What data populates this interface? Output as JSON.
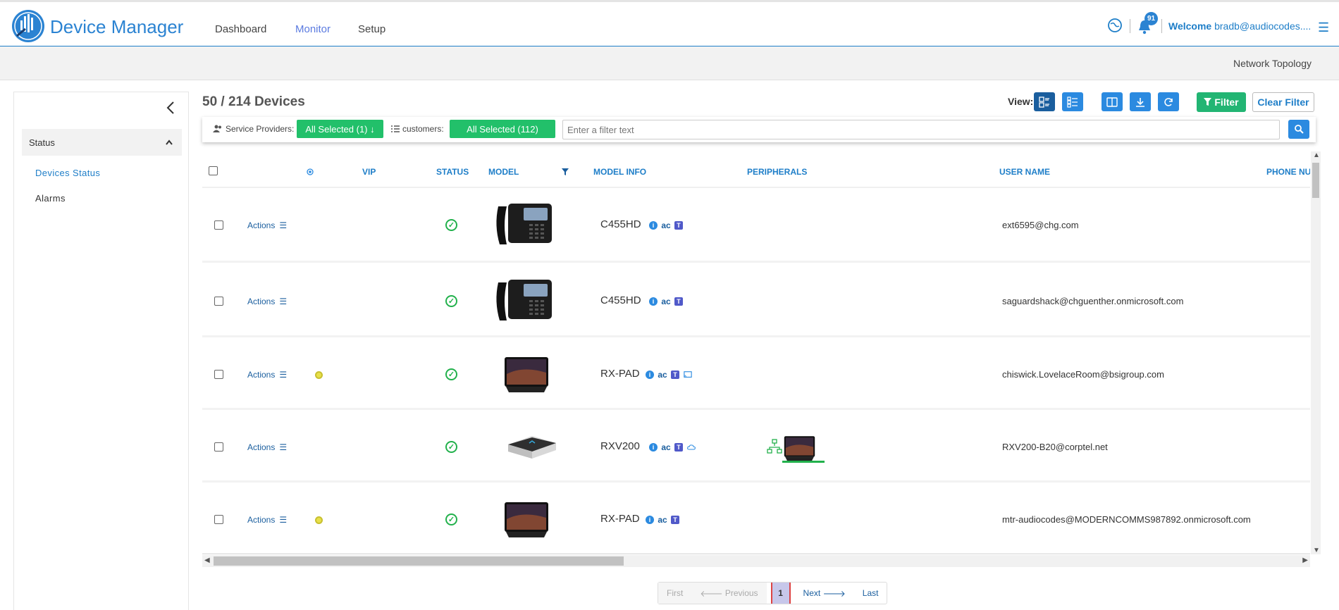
{
  "header": {
    "brand": "Device Manager",
    "nav": [
      {
        "label": "Dashboard"
      },
      {
        "label": "Monitor"
      },
      {
        "label": "Setup"
      }
    ],
    "notification_count": "91",
    "welcome_label": "Welcome",
    "welcome_user": "bradb@audiocodes...."
  },
  "subbar": {
    "title": "Network Topology"
  },
  "sidebar": {
    "section": "Status",
    "links": [
      {
        "label": "Devices Status"
      },
      {
        "label": "Alarms"
      }
    ]
  },
  "main": {
    "device_count": "50 / 214 Devices",
    "view_label": "View:",
    "filter_label": "Filter",
    "clear_filter_label": "Clear Filter",
    "filterbar": {
      "service_providers_label": "Service Providers:",
      "service_providers_value": "All Selected (1)",
      "customers_label": "customers:",
      "customers_value": "All Selected (112)",
      "filter_placeholder": "Enter a filter text"
    }
  },
  "table": {
    "columns": [
      "VIP",
      "STATUS",
      "MODEL",
      "MODEL INFO",
      "PERIPHERALS",
      "USER NAME",
      "PHONE NUI"
    ],
    "actions_label": "Actions",
    "rows": [
      {
        "model": "C455HD",
        "type": "phone",
        "vip": false,
        "extra_icon": "",
        "username": "ext6595@chg.com",
        "peripherals": false
      },
      {
        "model": "C455HD",
        "type": "phone",
        "vip": false,
        "extra_icon": "",
        "username": "saguardshack@chguenther.onmicrosoft.com",
        "peripherals": false
      },
      {
        "model": "RX-PAD",
        "type": "pad",
        "vip": true,
        "extra_icon": "cast-icon",
        "username": "chiswick.LovelaceRoom@bsigroup.com",
        "peripherals": false
      },
      {
        "model": "RXV200",
        "type": "rxv",
        "vip": false,
        "extra_icon": "cloud-icon",
        "username": "RXV200-B20@corptel.net",
        "peripherals": true
      },
      {
        "model": "RX-PAD",
        "type": "pad",
        "vip": true,
        "extra_icon": "",
        "username": "mtr-audiocodes@MODERNCOMMS987892.onmicrosoft.com",
        "peripherals": false
      }
    ]
  },
  "pagination": {
    "first": "First",
    "previous": "Previous",
    "current": "1",
    "next": "Next",
    "last": "Last"
  },
  "colors": {
    "brand": "#2b83d2",
    "green": "#22b573",
    "status_ok": "#22b14c"
  }
}
